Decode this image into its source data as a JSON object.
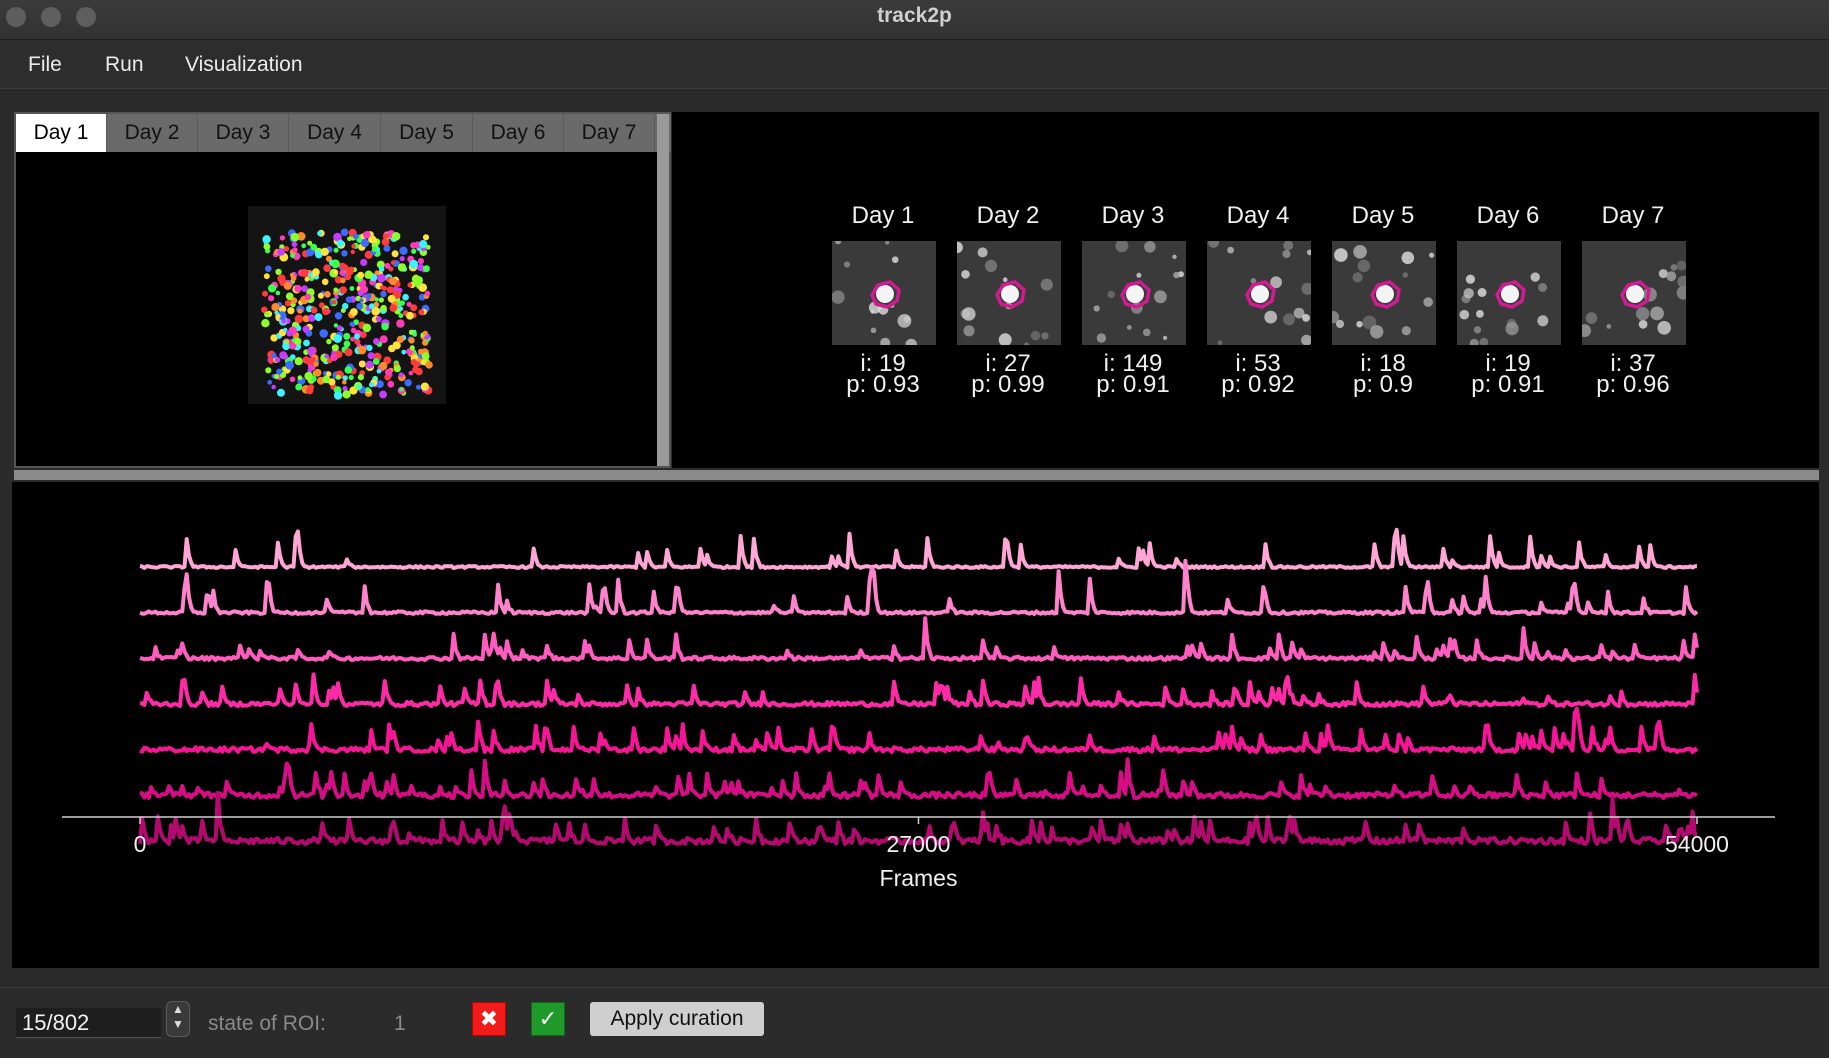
{
  "window": {
    "title": "track2p"
  },
  "menu": [
    "File",
    "Run",
    "Visualization"
  ],
  "tabs": [
    "Day 1",
    "Day 2",
    "Day 3",
    "Day 4",
    "Day 5",
    "Day 6",
    "Day 7"
  ],
  "active_tab": "Day 1",
  "roi_matches": [
    {
      "day": "Day 1",
      "i": "i: 19",
      "p": "p: 0.93"
    },
    {
      "day": "Day 2",
      "i": "i: 27",
      "p": "p: 0.99"
    },
    {
      "day": "Day 3",
      "i": "i: 149",
      "p": "p: 0.91"
    },
    {
      "day": "Day 4",
      "i": "i: 53",
      "p": "p: 0.92"
    },
    {
      "day": "Day 5",
      "i": "i: 18",
      "p": "p: 0.9"
    },
    {
      "day": "Day 6",
      "i": "i: 19",
      "p": "p: 0.91"
    },
    {
      "day": "Day 7",
      "i": "i: 37",
      "p": "p: 0.96"
    }
  ],
  "chart_data": {
    "type": "line",
    "xlabel": "Frames",
    "ylabel": "",
    "xlim": [
      0,
      54000
    ],
    "x_ticks": [
      "0",
      "27000",
      "54000"
    ],
    "series_count": 7,
    "colors": [
      "#ffa6d6",
      "#ff82cc",
      "#ff5cc0",
      "#ff2aa8",
      "#f51596",
      "#d60d84",
      "#b40a6f"
    ],
    "grid": false
  },
  "bottom": {
    "roi_counter": "15/802",
    "state_label": "state of ROI:",
    "state_value": "1",
    "reject_symbol": "✖",
    "accept_symbol": "✓",
    "apply_label": "Apply curation"
  }
}
